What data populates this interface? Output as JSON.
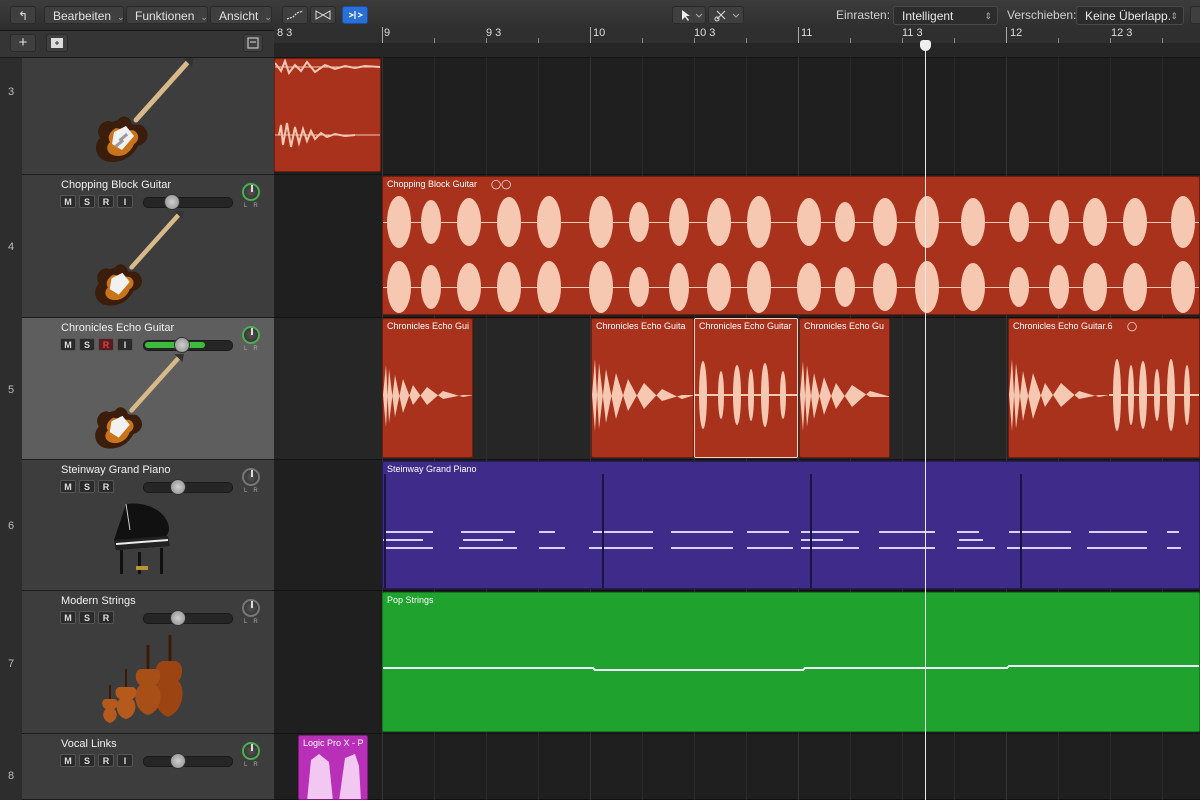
{
  "toolbar": {
    "back_glyph": "↰",
    "menus": [
      "Bearbeiten",
      "Funktionen",
      "Ansicht"
    ],
    "snap_label": "Einrasten:",
    "snap_value": "Intelligent",
    "drag_label": "Verschieben:",
    "drag_value": "Keine Überlapp.",
    "add_glyph": "+"
  },
  "ruler": {
    "labels": [
      "8 3",
      "9",
      "9 3",
      "10",
      "10 3",
      "11",
      "11 3",
      "12",
      "12 3"
    ]
  },
  "tracks": [
    {
      "number": "3",
      "name": "",
      "buttons": [],
      "instrument": "electric-guitar"
    },
    {
      "number": "4",
      "name": "Chopping Block Guitar",
      "buttons": [
        "M",
        "S",
        "R",
        "I"
      ],
      "instrument": "electric-guitar"
    },
    {
      "number": "5",
      "name": "Chronicles Echo Guitar",
      "buttons": [
        "M",
        "S",
        "R",
        "I"
      ],
      "instrument": "electric-guitar",
      "selected": true,
      "record_armed": true
    },
    {
      "number": "6",
      "name": "Steinway Grand Piano",
      "buttons": [
        "M",
        "S",
        "R"
      ],
      "instrument": "grand-piano"
    },
    {
      "number": "7",
      "name": "Modern Strings",
      "buttons": [
        "M",
        "S",
        "R"
      ],
      "instrument": "string-ensemble"
    },
    {
      "number": "8",
      "name": "Vocal Links",
      "buttons": [
        "M",
        "S",
        "R",
        "I"
      ],
      "instrument": "none"
    }
  ],
  "regions": {
    "chopping": "Chopping Block Guitar",
    "echo1": "Chronicles Echo Gui",
    "echo2": "Chronicles Echo Guita",
    "echo3": "Chronicles Echo Guitar",
    "echo4": "Chronicles Echo Gu",
    "echo5": "Chronicles Echo Guitar.6",
    "piano": "Steinway Grand Piano",
    "strings": "Pop Strings",
    "vocal": "Logic Pro X - P"
  },
  "colors": {
    "audio_region": "#a8321c",
    "midi_piano": "#3e2b8a",
    "midi_strings": "#1fa22e",
    "vocal_region": "#b82fb8",
    "record_on": "#d44444",
    "fader_level": "#3cbc3c"
  }
}
